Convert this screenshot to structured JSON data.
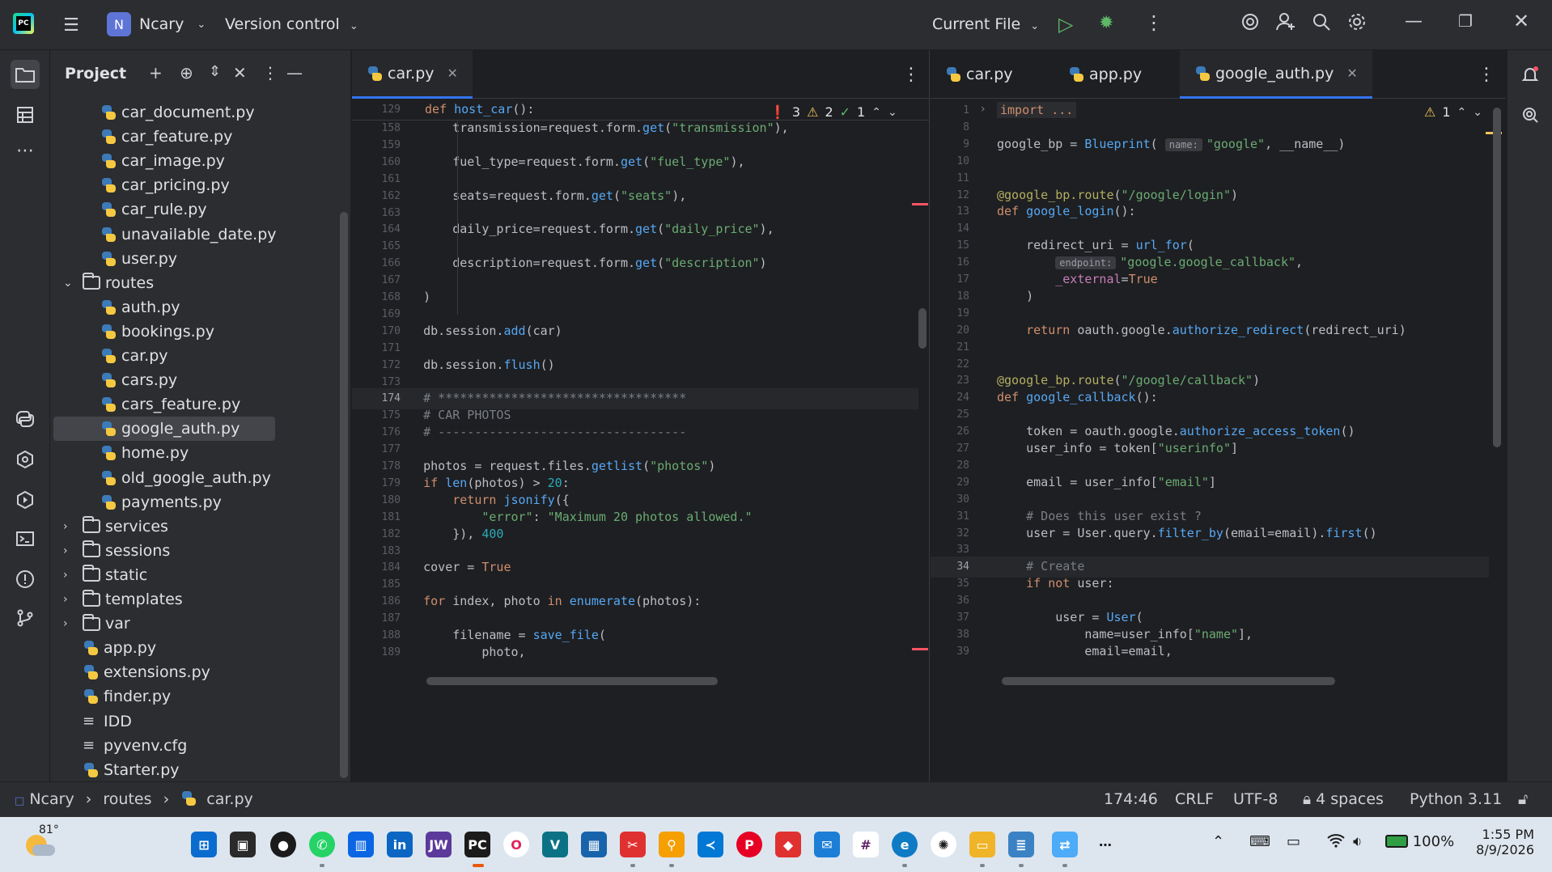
{
  "titlebar": {
    "project_badge": "N",
    "project_name": "Ncary",
    "vcs": "Version control",
    "run_config": "Current File"
  },
  "project_panel": {
    "title": "Project",
    "items": [
      {
        "label": "car_document.py",
        "type": "py",
        "depth": 3
      },
      {
        "label": "car_feature.py",
        "type": "py",
        "depth": 3
      },
      {
        "label": "car_image.py",
        "type": "py",
        "depth": 3
      },
      {
        "label": "car_pricing.py",
        "type": "py",
        "depth": 3
      },
      {
        "label": "car_rule.py",
        "type": "py",
        "depth": 3
      },
      {
        "label": "unavailable_date.py",
        "type": "py",
        "depth": 3
      },
      {
        "label": "user.py",
        "type": "py",
        "depth": 3
      },
      {
        "label": "routes",
        "type": "folder-open",
        "depth": 2
      },
      {
        "label": "auth.py",
        "type": "py",
        "depth": 3
      },
      {
        "label": "bookings.py",
        "type": "py",
        "depth": 3
      },
      {
        "label": "car.py",
        "type": "py",
        "depth": 3
      },
      {
        "label": "cars.py",
        "type": "py",
        "depth": 3
      },
      {
        "label": "cars_feature.py",
        "type": "py",
        "depth": 3
      },
      {
        "label": "google_auth.py",
        "type": "py",
        "depth": 3,
        "selected": true
      },
      {
        "label": "home.py",
        "type": "py",
        "depth": 3
      },
      {
        "label": "old_google_auth.py",
        "type": "py",
        "depth": 3
      },
      {
        "label": "payments.py",
        "type": "py",
        "depth": 3
      },
      {
        "label": "services",
        "type": "folder",
        "depth": 2
      },
      {
        "label": "sessions",
        "type": "folder",
        "depth": 2
      },
      {
        "label": "static",
        "type": "folder",
        "depth": 2
      },
      {
        "label": "templates",
        "type": "folder",
        "depth": 2
      },
      {
        "label": "var",
        "type": "folder",
        "depth": 2
      },
      {
        "label": "app.py",
        "type": "py",
        "depth": 2
      },
      {
        "label": "extensions.py",
        "type": "py",
        "depth": 2
      },
      {
        "label": "finder.py",
        "type": "py",
        "depth": 2
      },
      {
        "label": "IDD",
        "type": "text",
        "depth": 2
      },
      {
        "label": "pyvenv.cfg",
        "type": "text",
        "depth": 2
      },
      {
        "label": "Starter.py",
        "type": "py",
        "depth": 2
      }
    ]
  },
  "editor_left": {
    "tab": "car.py",
    "sticky_line": "129",
    "sticky_code": "def host_car():",
    "errors": "3",
    "warnings": "2",
    "ok": "1",
    "current_line": "174",
    "lines": [
      {
        "n": "158",
        "html": "        transmission=request.form.get(\"transmission\"),"
      },
      {
        "n": "159",
        "html": ""
      },
      {
        "n": "160",
        "html": "        fuel_type=request.form.get(\"fuel_type\"),"
      },
      {
        "n": "161",
        "html": ""
      },
      {
        "n": "162",
        "html": "        seats=request.form.get(\"seats\"),"
      },
      {
        "n": "163",
        "html": ""
      },
      {
        "n": "164",
        "html": "        daily_price=request.form.get(\"daily_price\"),"
      },
      {
        "n": "165",
        "html": ""
      },
      {
        "n": "166",
        "html": "        description=request.form.get(\"description\")"
      },
      {
        "n": "167",
        "html": ""
      },
      {
        "n": "168",
        "html": "    )"
      },
      {
        "n": "169",
        "html": ""
      },
      {
        "n": "170",
        "html": "    db.session.add(car)"
      },
      {
        "n": "171",
        "html": ""
      },
      {
        "n": "172",
        "html": "    db.session.flush()"
      },
      {
        "n": "173",
        "html": ""
      },
      {
        "n": "174",
        "html": "    # **********************************"
      },
      {
        "n": "175",
        "html": "    # CAR PHOTOS"
      },
      {
        "n": "176",
        "html": "    # ----------------------------------"
      },
      {
        "n": "177",
        "html": ""
      },
      {
        "n": "178",
        "html": "    photos = request.files.getlist(\"photos\")"
      },
      {
        "n": "179",
        "html": "    if len(photos) > 20:"
      },
      {
        "n": "180",
        "html": "        return jsonify({"
      },
      {
        "n": "181",
        "html": "            \"error\": \"Maximum 20 photos allowed.\""
      },
      {
        "n": "182",
        "html": "        }), 400"
      },
      {
        "n": "183",
        "html": ""
      },
      {
        "n": "184",
        "html": "    cover = True"
      },
      {
        "n": "185",
        "html": ""
      },
      {
        "n": "186",
        "html": "    for index, photo in enumerate(photos):"
      },
      {
        "n": "187",
        "html": ""
      },
      {
        "n": "188",
        "html": "        filename = save_file("
      },
      {
        "n": "189",
        "html": "            photo,"
      }
    ]
  },
  "editor_right": {
    "tabs": [
      "car.py",
      "app.py",
      "google_auth.py"
    ],
    "warnings": "1",
    "current_line": "34",
    "hint_name": "name:",
    "hint_endpoint": "endpoint:",
    "lines": [
      {
        "n": "1",
        "text": "import ..."
      },
      {
        "n": "8",
        "text": ""
      },
      {
        "n": "9",
        "text": "google_bp = Blueprint( \"google\", __name__)"
      },
      {
        "n": "10",
        "text": ""
      },
      {
        "n": "11",
        "text": ""
      },
      {
        "n": "12",
        "text": "@google_bp.route(\"/google/login\")"
      },
      {
        "n": "13",
        "text": "def google_login():"
      },
      {
        "n": "14",
        "text": ""
      },
      {
        "n": "15",
        "text": "    redirect_uri = url_for("
      },
      {
        "n": "16",
        "text": "         \"google.google_callback\","
      },
      {
        "n": "17",
        "text": "        _external=True"
      },
      {
        "n": "18",
        "text": "    )"
      },
      {
        "n": "19",
        "text": ""
      },
      {
        "n": "20",
        "text": "    return oauth.google.authorize_redirect(redirect_uri)"
      },
      {
        "n": "21",
        "text": ""
      },
      {
        "n": "22",
        "text": ""
      },
      {
        "n": "23",
        "text": "@google_bp.route(\"/google/callback\")"
      },
      {
        "n": "24",
        "text": "def google_callback():"
      },
      {
        "n": "25",
        "text": ""
      },
      {
        "n": "26",
        "text": "    token = oauth.google.authorize_access_token()"
      },
      {
        "n": "27",
        "text": "    user_info = token[\"userinfo\"]"
      },
      {
        "n": "28",
        "text": ""
      },
      {
        "n": "29",
        "text": "    email = user_info[\"email\"]"
      },
      {
        "n": "30",
        "text": ""
      },
      {
        "n": "31",
        "text": "    # Does this user exist ?"
      },
      {
        "n": "32",
        "text": "    user = User.query.filter_by(email=email).first()"
      },
      {
        "n": "33",
        "text": ""
      },
      {
        "n": "34",
        "text": "    # Create"
      },
      {
        "n": "35",
        "text": "    if not user:"
      },
      {
        "n": "36",
        "text": ""
      },
      {
        "n": "37",
        "text": "        user = User("
      },
      {
        "n": "38",
        "text": "            name=user_info[\"name\"],"
      },
      {
        "n": "39",
        "text": "            email=email,"
      }
    ]
  },
  "statusbar": {
    "crumb_project": "Ncary",
    "crumb_folder": "routes",
    "crumb_file": "car.py",
    "position": "174:46",
    "line_sep": "CRLF",
    "encoding": "UTF-8",
    "indent": "4 spaces",
    "interpreter": "Python 3.11"
  },
  "taskbar": {
    "weather": "81°",
    "time": "1:55 PM",
    "date": "8/9/2026",
    "battery": "100%"
  },
  "colors": {
    "accent": "#3574f0",
    "error": "#f75464",
    "warning": "#f2c55c",
    "run": "#5fb865"
  }
}
